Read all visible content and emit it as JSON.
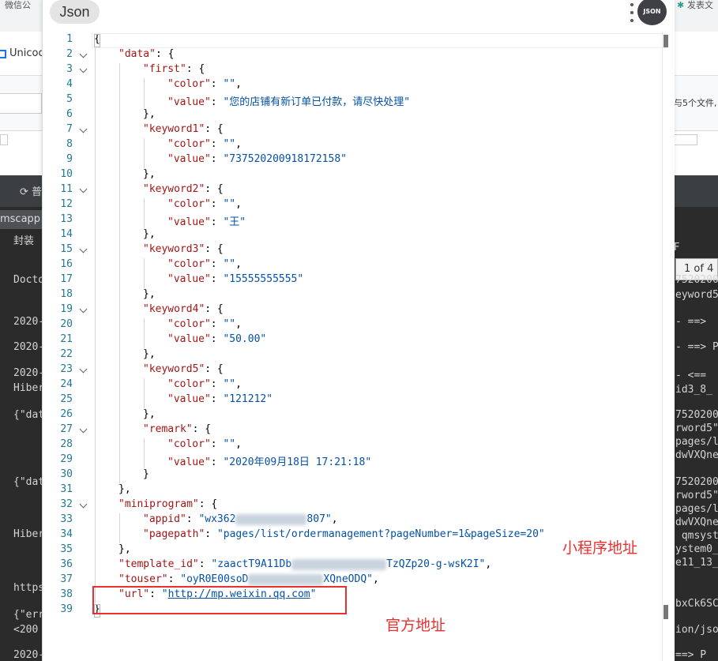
{
  "background": {
    "tab_left": "微信公",
    "tab_right": "发表文",
    "unicode_label": "Unicoc",
    "right_note": "与5个文件,",
    "dark_header_label": "普",
    "dark_tab_label": "mscapp",
    "left_lines": [
      "封装",
      "",
      "Docto",
      "",
      "2020-",
      "2020-",
      "2020-",
      "Hiber",
      "{\"dat",
      "{\"dat",
      "Hiber",
      "https",
      "{\"err",
      "<200",
      "2020-"
    ],
    "right_page": "1 of 4",
    "right_tab": "F",
    "right_lines": [
      "7520200",
      "eyword5",
      "- ==>",
      "- ==> P",
      "- <==",
      "id3_8_",
      "7520200",
      "rword5\":",
      "pages/l",
      "dwVXQne",
      "7520200",
      "rword5\":",
      "pages/l",
      "dwVXQne",
      " qmsyst",
      "ystem0_",
      "e11_13_",
      "bxCk6SC",
      "ion/jso",
      "==> P"
    ]
  },
  "viewer": {
    "tab_label": "Json",
    "avatar_text": "JSON",
    "lines": [
      {
        "n": "1",
        "fold": false,
        "ind": 0,
        "parts": [
          {
            "t": "p",
            "v": "{"
          }
        ]
      },
      {
        "n": "2",
        "fold": true,
        "ind": 1,
        "parts": [
          {
            "t": "k",
            "v": "\"data\""
          },
          {
            "t": "p",
            "v": ": {"
          }
        ]
      },
      {
        "n": "3",
        "fold": true,
        "ind": 2,
        "parts": [
          {
            "t": "k",
            "v": "\"first\""
          },
          {
            "t": "p",
            "v": ": {"
          }
        ]
      },
      {
        "n": "4",
        "fold": false,
        "ind": 3,
        "parts": [
          {
            "t": "k",
            "v": "\"color\""
          },
          {
            "t": "p",
            "v": ": "
          },
          {
            "t": "s",
            "v": "\"\""
          },
          {
            "t": "p",
            "v": ","
          }
        ]
      },
      {
        "n": "5",
        "fold": false,
        "ind": 3,
        "parts": [
          {
            "t": "k",
            "v": "\"value\""
          },
          {
            "t": "p",
            "v": ": "
          },
          {
            "t": "s",
            "v": "\"您的店铺有新订单已付款，请尽快处理\""
          }
        ]
      },
      {
        "n": "6",
        "fold": false,
        "ind": 2,
        "parts": [
          {
            "t": "p",
            "v": "},"
          }
        ]
      },
      {
        "n": "7",
        "fold": true,
        "ind": 2,
        "parts": [
          {
            "t": "k",
            "v": "\"keyword1\""
          },
          {
            "t": "p",
            "v": ": {"
          }
        ]
      },
      {
        "n": "8",
        "fold": false,
        "ind": 3,
        "parts": [
          {
            "t": "k",
            "v": "\"color\""
          },
          {
            "t": "p",
            "v": ": "
          },
          {
            "t": "s",
            "v": "\"\""
          },
          {
            "t": "p",
            "v": ","
          }
        ]
      },
      {
        "n": "9",
        "fold": false,
        "ind": 3,
        "parts": [
          {
            "t": "k",
            "v": "\"value\""
          },
          {
            "t": "p",
            "v": ": "
          },
          {
            "t": "s",
            "v": "\"737520200918172158\""
          }
        ]
      },
      {
        "n": "10",
        "fold": false,
        "ind": 2,
        "parts": [
          {
            "t": "p",
            "v": "},"
          }
        ]
      },
      {
        "n": "11",
        "fold": true,
        "ind": 2,
        "parts": [
          {
            "t": "k",
            "v": "\"keyword2\""
          },
          {
            "t": "p",
            "v": ": {"
          }
        ]
      },
      {
        "n": "12",
        "fold": false,
        "ind": 3,
        "parts": [
          {
            "t": "k",
            "v": "\"color\""
          },
          {
            "t": "p",
            "v": ": "
          },
          {
            "t": "s",
            "v": "\"\""
          },
          {
            "t": "p",
            "v": ","
          }
        ]
      },
      {
        "n": "13",
        "fold": false,
        "ind": 3,
        "parts": [
          {
            "t": "k",
            "v": "\"value\""
          },
          {
            "t": "p",
            "v": ": "
          },
          {
            "t": "s",
            "v": "\"王\""
          }
        ]
      },
      {
        "n": "14",
        "fold": false,
        "ind": 2,
        "parts": [
          {
            "t": "p",
            "v": "},"
          }
        ]
      },
      {
        "n": "15",
        "fold": true,
        "ind": 2,
        "parts": [
          {
            "t": "k",
            "v": "\"keyword3\""
          },
          {
            "t": "p",
            "v": ": {"
          }
        ]
      },
      {
        "n": "16",
        "fold": false,
        "ind": 3,
        "parts": [
          {
            "t": "k",
            "v": "\"color\""
          },
          {
            "t": "p",
            "v": ": "
          },
          {
            "t": "s",
            "v": "\"\""
          },
          {
            "t": "p",
            "v": ","
          }
        ]
      },
      {
        "n": "17",
        "fold": false,
        "ind": 3,
        "parts": [
          {
            "t": "k",
            "v": "\"value\""
          },
          {
            "t": "p",
            "v": ": "
          },
          {
            "t": "s",
            "v": "\"15555555555\""
          }
        ]
      },
      {
        "n": "18",
        "fold": false,
        "ind": 2,
        "parts": [
          {
            "t": "p",
            "v": "},"
          }
        ]
      },
      {
        "n": "19",
        "fold": true,
        "ind": 2,
        "parts": [
          {
            "t": "k",
            "v": "\"keyword4\""
          },
          {
            "t": "p",
            "v": ": {"
          }
        ]
      },
      {
        "n": "20",
        "fold": false,
        "ind": 3,
        "parts": [
          {
            "t": "k",
            "v": "\"color\""
          },
          {
            "t": "p",
            "v": ": "
          },
          {
            "t": "s",
            "v": "\"\""
          },
          {
            "t": "p",
            "v": ","
          }
        ]
      },
      {
        "n": "21",
        "fold": false,
        "ind": 3,
        "parts": [
          {
            "t": "k",
            "v": "\"value\""
          },
          {
            "t": "p",
            "v": ": "
          },
          {
            "t": "s",
            "v": "\"50.00\""
          }
        ]
      },
      {
        "n": "22",
        "fold": false,
        "ind": 2,
        "parts": [
          {
            "t": "p",
            "v": "},"
          }
        ]
      },
      {
        "n": "23",
        "fold": true,
        "ind": 2,
        "parts": [
          {
            "t": "k",
            "v": "\"keyword5\""
          },
          {
            "t": "p",
            "v": ": {"
          }
        ]
      },
      {
        "n": "24",
        "fold": false,
        "ind": 3,
        "parts": [
          {
            "t": "k",
            "v": "\"color\""
          },
          {
            "t": "p",
            "v": ": "
          },
          {
            "t": "s",
            "v": "\"\""
          },
          {
            "t": "p",
            "v": ","
          }
        ]
      },
      {
        "n": "25",
        "fold": false,
        "ind": 3,
        "parts": [
          {
            "t": "k",
            "v": "\"value\""
          },
          {
            "t": "p",
            "v": ": "
          },
          {
            "t": "s",
            "v": "\"121212\""
          }
        ]
      },
      {
        "n": "26",
        "fold": false,
        "ind": 2,
        "parts": [
          {
            "t": "p",
            "v": "},"
          }
        ]
      },
      {
        "n": "27",
        "fold": true,
        "ind": 2,
        "parts": [
          {
            "t": "k",
            "v": "\"remark\""
          },
          {
            "t": "p",
            "v": ": {"
          }
        ]
      },
      {
        "n": "28",
        "fold": false,
        "ind": 3,
        "parts": [
          {
            "t": "k",
            "v": "\"color\""
          },
          {
            "t": "p",
            "v": ": "
          },
          {
            "t": "s",
            "v": "\"\""
          },
          {
            "t": "p",
            "v": ","
          }
        ]
      },
      {
        "n": "29",
        "fold": false,
        "ind": 3,
        "parts": [
          {
            "t": "k",
            "v": "\"value\""
          },
          {
            "t": "p",
            "v": ": "
          },
          {
            "t": "s",
            "v": "\"2020年09月18日 17:21:18\""
          }
        ]
      },
      {
        "n": "30",
        "fold": false,
        "ind": 2,
        "parts": [
          {
            "t": "p",
            "v": "}"
          }
        ]
      },
      {
        "n": "31",
        "fold": false,
        "ind": 1,
        "parts": [
          {
            "t": "p",
            "v": "},"
          }
        ]
      },
      {
        "n": "32",
        "fold": true,
        "ind": 1,
        "parts": [
          {
            "t": "k",
            "v": "\"miniprogram\""
          },
          {
            "t": "p",
            "v": ": {"
          }
        ]
      },
      {
        "n": "33",
        "fold": false,
        "ind": 2,
        "parts": [
          {
            "t": "k",
            "v": "\"appid\""
          },
          {
            "t": "p",
            "v": ": "
          },
          {
            "t": "s",
            "v": "\"wx362"
          },
          {
            "t": "b",
            "v": "90"
          },
          {
            "t": "s",
            "v": "807\""
          },
          {
            "t": "p",
            "v": ","
          }
        ]
      },
      {
        "n": "34",
        "fold": false,
        "ind": 2,
        "parts": [
          {
            "t": "k",
            "v": "\"pagepath\""
          },
          {
            "t": "p",
            "v": ": "
          },
          {
            "t": "s",
            "v": "\"pages/list/ordermanagement?pageNumber=1&pageSize=20\""
          }
        ]
      },
      {
        "n": "35",
        "fold": false,
        "ind": 1,
        "parts": [
          {
            "t": "p",
            "v": "},"
          }
        ]
      },
      {
        "n": "36",
        "fold": false,
        "ind": 1,
        "parts": [
          {
            "t": "k",
            "v": "\"template_id\""
          },
          {
            "t": "p",
            "v": ": "
          },
          {
            "t": "s",
            "v": "\"zaactT9A11Db"
          },
          {
            "t": "b",
            "v": "120"
          },
          {
            "t": "s",
            "v": "TzQZp20-g-wsK2I\""
          },
          {
            "t": "p",
            "v": ","
          }
        ]
      },
      {
        "n": "37",
        "fold": false,
        "ind": 1,
        "parts": [
          {
            "t": "k",
            "v": "\"touser\""
          },
          {
            "t": "p",
            "v": ": "
          },
          {
            "t": "s",
            "v": "\"oyR0E00soD"
          },
          {
            "t": "b",
            "v": "95"
          },
          {
            "t": "s",
            "v": "XQneODQ\""
          },
          {
            "t": "p",
            "v": ","
          }
        ]
      },
      {
        "n": "38",
        "fold": false,
        "ind": 1,
        "parts": [
          {
            "t": "k",
            "v": "\"url\""
          },
          {
            "t": "p",
            "v": ": "
          },
          {
            "t": "s",
            "v": "\""
          },
          {
            "t": "u",
            "v": "http://mp.weixin.qq.com"
          },
          {
            "t": "s",
            "v": "\""
          }
        ]
      },
      {
        "n": "39",
        "fold": false,
        "ind": 0,
        "parts": [
          {
            "t": "p",
            "v": "}"
          }
        ]
      }
    ]
  },
  "annotations": {
    "miniprogram_note": "小程序地址",
    "official_note": "官方地址",
    "box_color": "#e8312f"
  }
}
